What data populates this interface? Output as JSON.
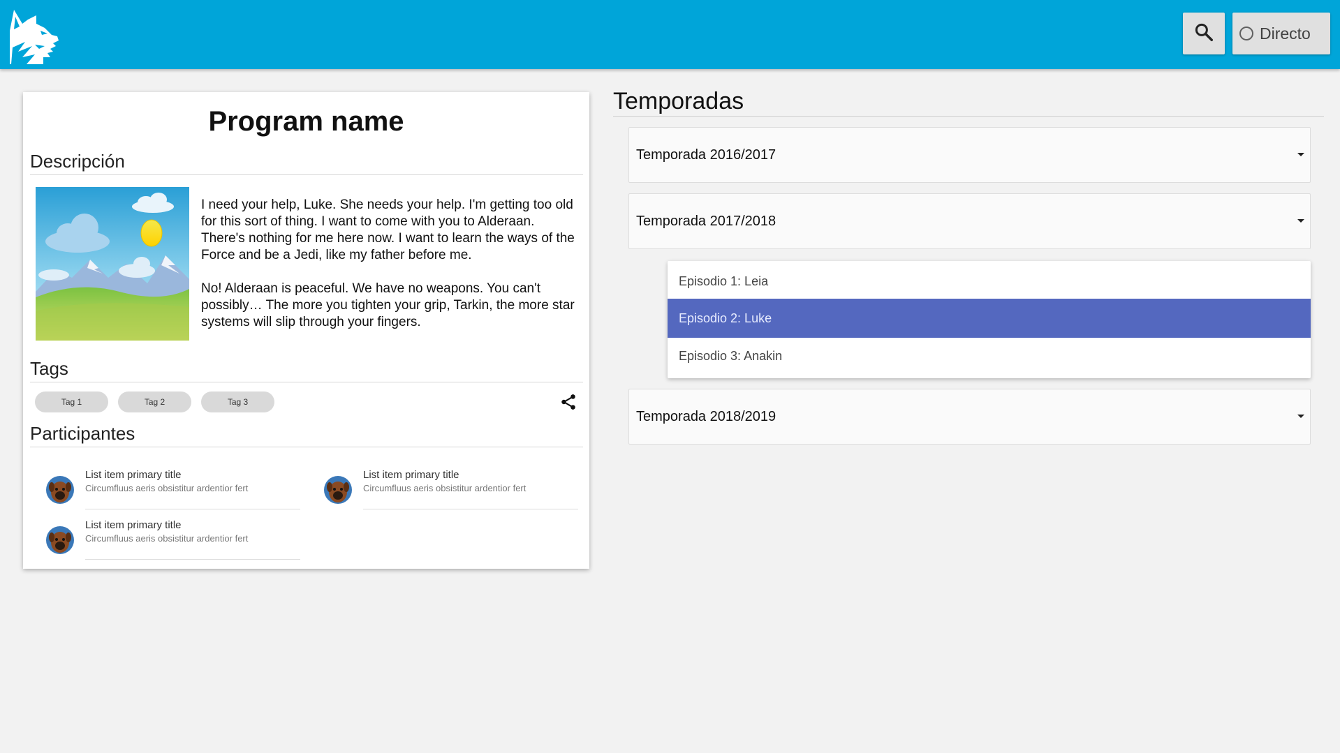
{
  "header": {
    "search_icon": "search-icon",
    "live_label": "Directo",
    "live_icon": "radio-circle-icon",
    "bar_color": "#00a5d9"
  },
  "program": {
    "title": "Program name",
    "description_heading": "Descripción",
    "description_paragraphs": [
      "I need your help, Luke. She needs your help. I'm getting too old for this sort of thing. I want to come with you to Alderaan. There's nothing for me here now. I want to learn the ways of the Force and be a Jedi, like my father before me.",
      "No! Alderaan is peaceful. We have no weapons. You can't possibly… The more you tighten your grip, Tarkin, the more star systems will slip through your fingers."
    ],
    "tags_heading": "Tags",
    "tags": [
      "Tag 1",
      "Tag 2",
      "Tag 3"
    ],
    "share_icon": "share-icon",
    "participants_heading": "Participantes",
    "participants": [
      {
        "title": "List item primary title",
        "subtitle": "Circumfluus aeris obsistitur ardentior fert"
      },
      {
        "title": "List item primary title",
        "subtitle": "Circumfluus aeris obsistitur ardentior fert"
      },
      {
        "title": "List item primary title",
        "subtitle": "Circumfluus aeris obsistitur ardentior fert"
      }
    ]
  },
  "seasons": {
    "heading": "Temporadas",
    "items": [
      {
        "label": "Temporada 2016/2017"
      },
      {
        "label": "Temporada 2017/2018"
      },
      {
        "label": "Temporada 2018/2019"
      }
    ],
    "open_episodes": [
      {
        "label": "Episodio 1: Leia"
      },
      {
        "label": "Episodio 2: Luke",
        "selected": true
      },
      {
        "label": "Episodio 3: Anakin"
      }
    ],
    "selected_color": "#5468bf"
  }
}
